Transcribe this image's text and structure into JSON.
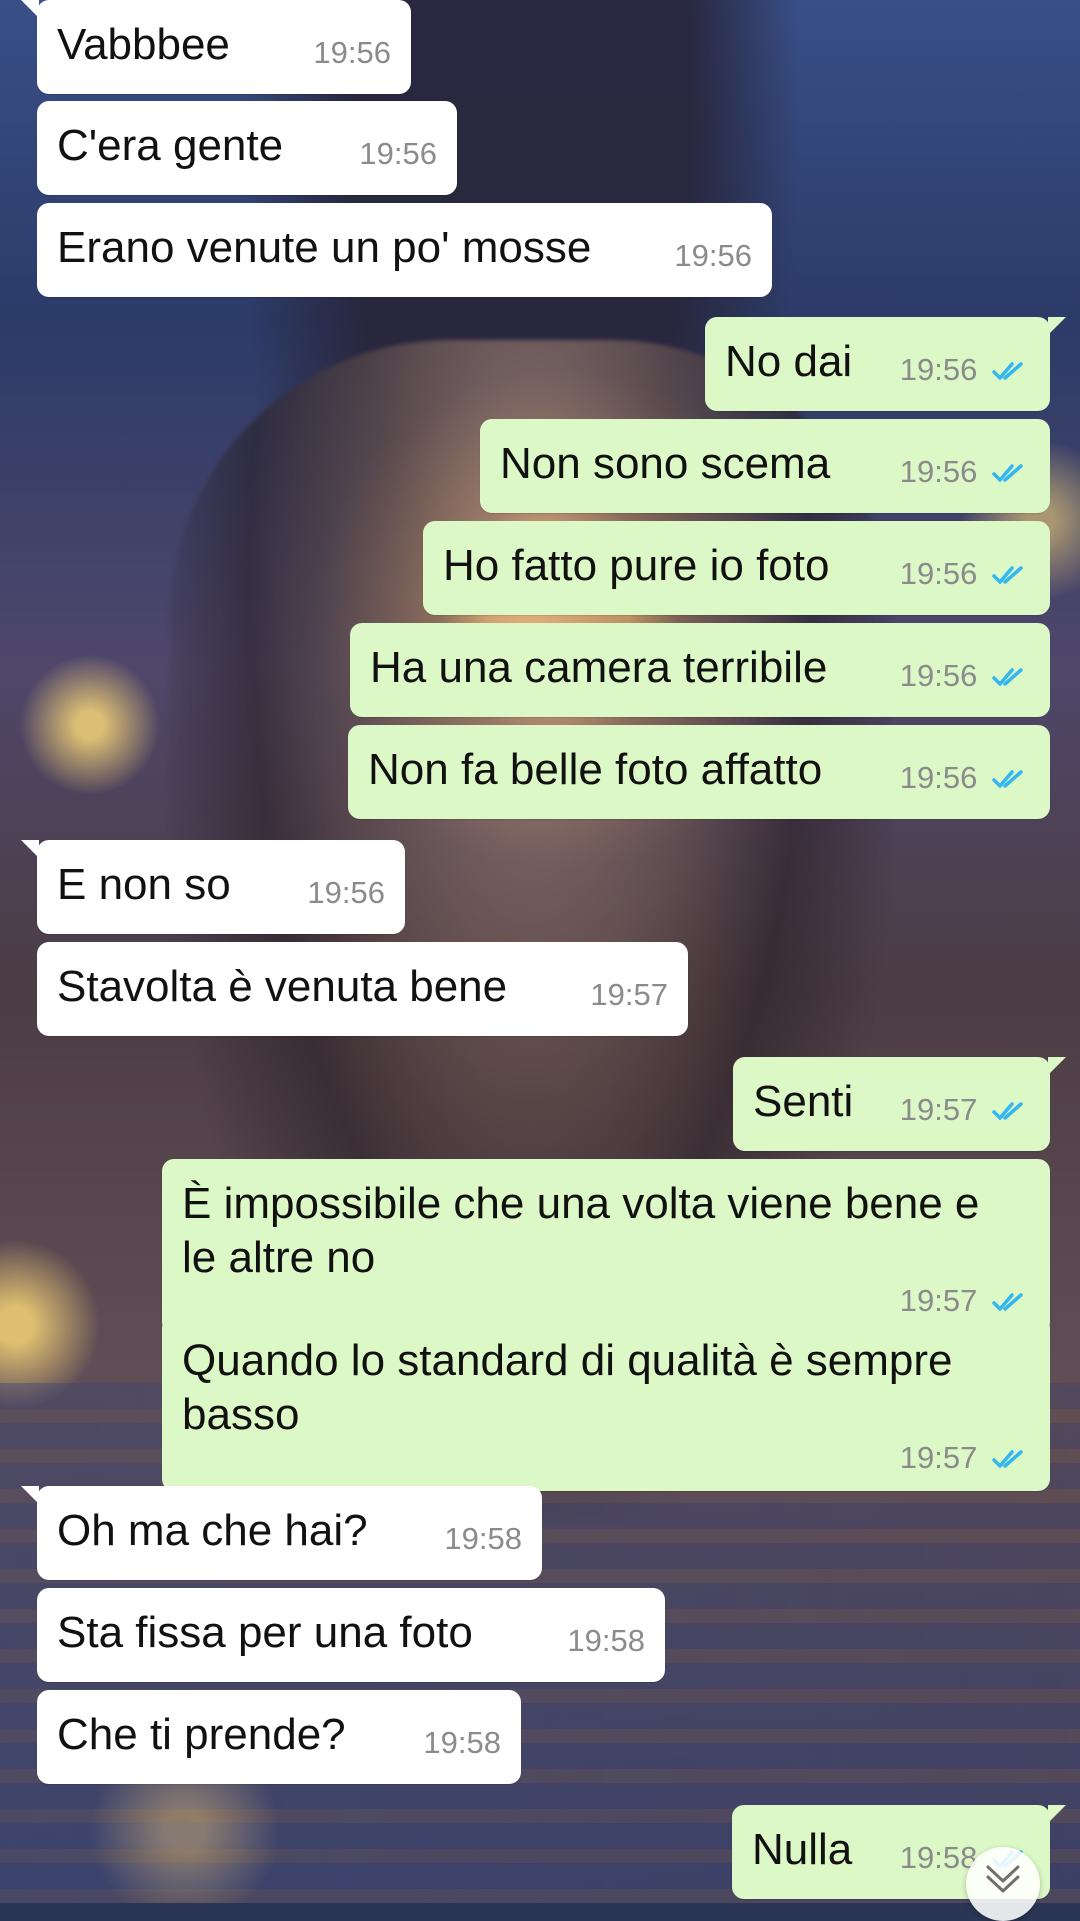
{
  "chat": {
    "messages": [
      {
        "text": "Vabbbee",
        "time": "19:56"
      },
      {
        "text": "C'era gente",
        "time": "19:56"
      },
      {
        "text": "Erano venute un po' mosse",
        "time": "19:56"
      },
      {
        "text": "No dai",
        "time": "19:56"
      },
      {
        "text": "Non sono scema",
        "time": "19:56"
      },
      {
        "text": "Ho fatto pure io foto",
        "time": "19:56"
      },
      {
        "text": "Ha una camera terribile",
        "time": "19:56"
      },
      {
        "text": "Non fa belle foto affatto",
        "time": "19:56"
      },
      {
        "text": "E non so",
        "time": "19:56"
      },
      {
        "text": "Stavolta è venuta bene",
        "time": "19:57"
      },
      {
        "text": "Senti",
        "time": "19:57"
      },
      {
        "text": "È impossibile che una volta viene bene e\nle altre no",
        "time": "19:57"
      },
      {
        "text": "Quando lo standard di qualità è sempre\nbasso",
        "time": "19:57"
      },
      {
        "text": "Oh ma che hai?",
        "time": "19:58"
      },
      {
        "text": "Sta fissa per una foto",
        "time": "19:58"
      },
      {
        "text": "Che ti prende?",
        "time": "19:58"
      },
      {
        "text": "Nulla",
        "time": "19:58"
      }
    ]
  },
  "icons": {
    "read_receipt": "double-check-icon",
    "scroll": "chevron-down-icon"
  },
  "colors": {
    "incoming_bubble": "#ffffff",
    "outgoing_bubble": "#dcf8c6",
    "read_tick": "#34b7f1",
    "timestamp": "#8b8b8b"
  }
}
